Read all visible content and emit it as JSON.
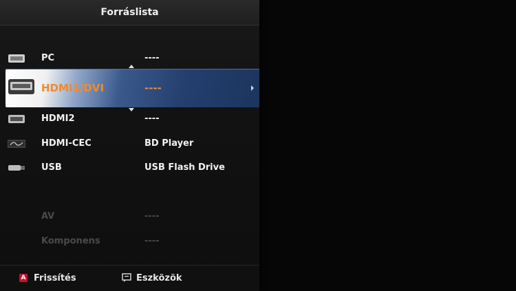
{
  "window": {
    "title": "Forráslista"
  },
  "sources": [
    {
      "name": "PC",
      "device": "----",
      "icon": "pc-icon",
      "state": "normal"
    },
    {
      "name": "HDMI1/DVI",
      "device": "----",
      "icon": "hdmi-icon",
      "state": "selected"
    },
    {
      "name": "HDMI2",
      "device": "----",
      "icon": "hdmi-icon",
      "state": "normal"
    },
    {
      "name": "HDMI-CEC",
      "device": "BD Player",
      "icon": "anynet-icon",
      "state": "normal"
    },
    {
      "name": "USB",
      "device": "USB Flash Drive",
      "icon": "usb-icon",
      "state": "normal"
    },
    {
      "name": "AV",
      "device": "----",
      "icon": "",
      "state": "disabled"
    },
    {
      "name": "Komponens",
      "device": "----",
      "icon": "",
      "state": "disabled"
    }
  ],
  "footer": {
    "refresh_key": "A",
    "refresh_label": "Frissítés",
    "tools_label": "Eszközök"
  },
  "colors": {
    "selected_text": "#f28a2e",
    "key_red": "#c8102e",
    "selection_blue": "#233f6e"
  }
}
